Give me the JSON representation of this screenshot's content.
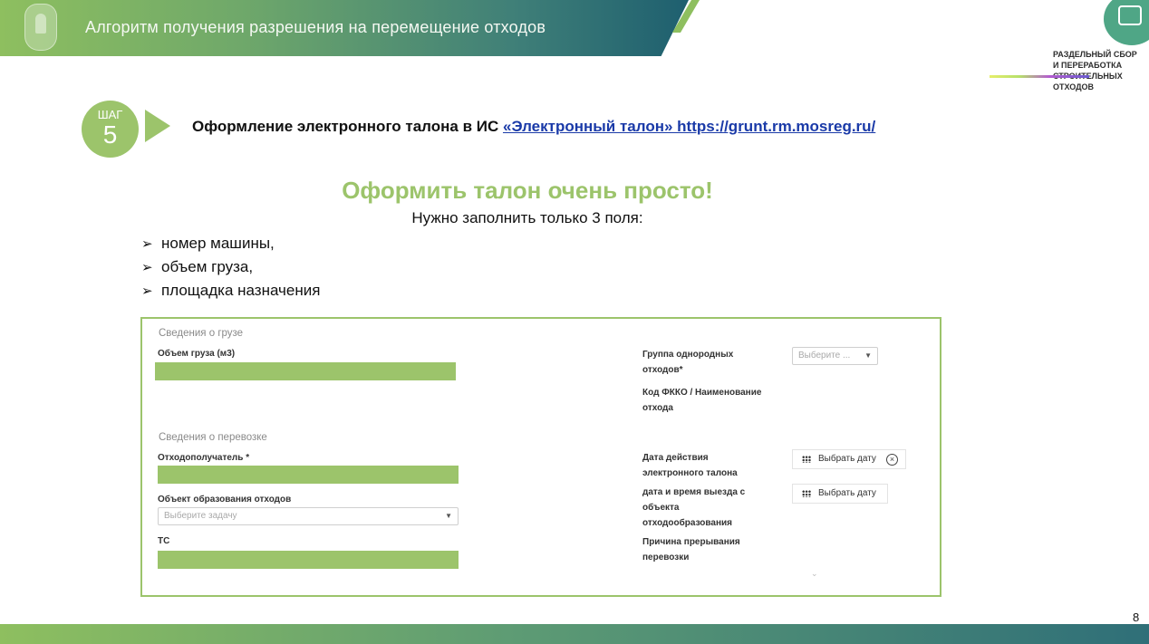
{
  "header": {
    "title": "Алгоритм получения разрешения на перемещение отходов"
  },
  "logo": {
    "lines": [
      "РАЗДЕЛЬНЫЙ СБОР",
      "И ПЕРЕРАБОТКА",
      "СТРОИТЕЛЬНЫХ",
      "ОТХОДОВ"
    ]
  },
  "step": {
    "word": "ШАГ",
    "number": "5",
    "text_prefix": "Оформление электронного талона в ИС ",
    "link_text": "«Электронный талон» https://grunt.rm.mosreg.ru/"
  },
  "headline": "Оформить талон очень просто!",
  "subline": "Нужно заполнить только 3 поля:",
  "bullets": [
    {
      "marker": "➢",
      "text": "номер машины,"
    },
    {
      "marker": "➢",
      "text": "объем груза,"
    },
    {
      "marker": "➢",
      "text": "площадка назначения"
    }
  ],
  "form": {
    "cargo_section": "Сведения о грузе",
    "volume_label": "Объем груза (м3)",
    "waste_group_label": "Группа однородных отходов*",
    "waste_group_placeholder": "Выберите ...",
    "fkko_label": "Код ФККО / Наименование отхода",
    "transport_section": "Сведения о перевозке",
    "recipient_label": "Отходополучатель *",
    "object_label": "Объект образования отходов",
    "object_placeholder": "Выберите задачу",
    "vehicle_label": "ТС",
    "valid_date_label": "Дата действия электронного талона",
    "valid_date_button": "Выбрать дату",
    "departure_label": "дата и время выезда с объекта отходообразования",
    "departure_button": "Выбрать дату",
    "interrupt_label": "Причина прерывания перевозки"
  },
  "colors": {
    "accent_green": "#9cc46b",
    "link_blue": "#1a3aa8",
    "banner_dark": "#1e5f6f"
  },
  "page_number": "8"
}
